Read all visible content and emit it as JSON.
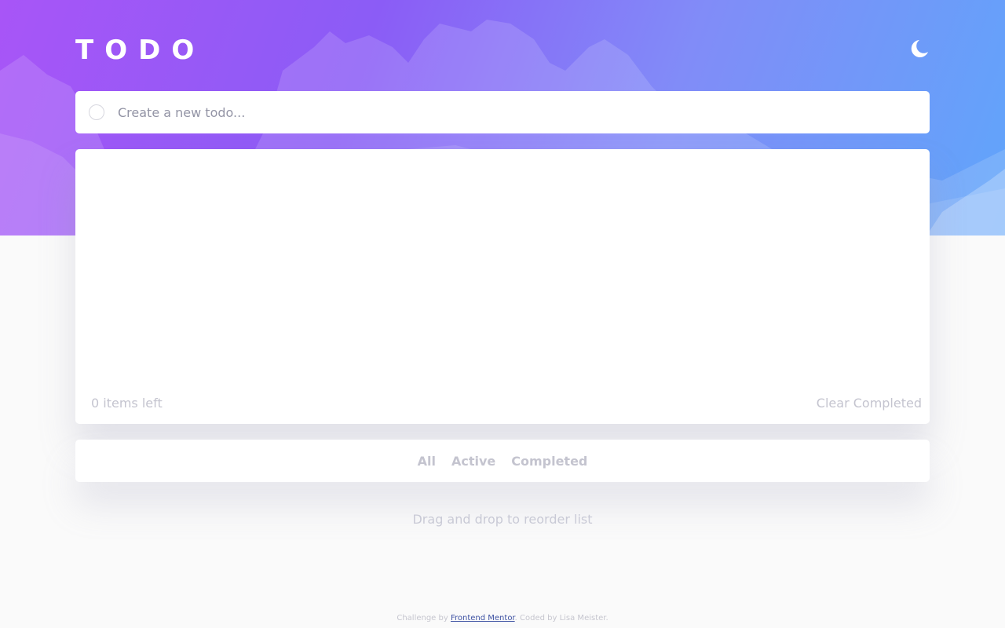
{
  "app": {
    "title": "TODO"
  },
  "header": {
    "theme_toggle_icon": "moon-icon"
  },
  "new_todo": {
    "placeholder": "Create a new todo...",
    "value": ""
  },
  "list": {
    "items": [],
    "items_left": "0 items left",
    "clear_completed_label": "Clear Completed"
  },
  "filters": {
    "all": "All",
    "active": "Active",
    "completed": "Completed"
  },
  "hint": "Drag and drop to reorder list",
  "footer": {
    "challenge_prefix": "Challenge by",
    "challenge_link": "Frontend Mentor",
    "coded_by": ". Coded by Lisa Meister."
  },
  "colors": {
    "gradient_start": "#a855f7",
    "gradient_end": "#60a5fa",
    "page_background": "#fafafa",
    "muted_text": "#c4c4cf",
    "link": "#3e52a3"
  }
}
